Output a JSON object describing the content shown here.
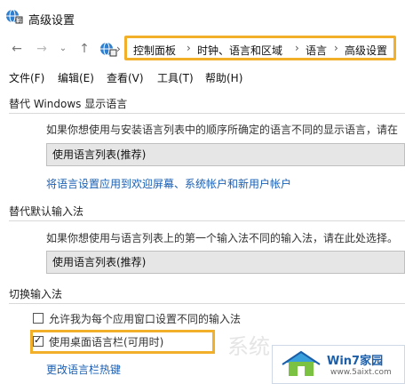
{
  "window": {
    "title": "高级设置"
  },
  "nav": {
    "breadcrumbs": [
      "控制面板",
      "时钟、语言和区域",
      "语言",
      "高级设置"
    ]
  },
  "menu": {
    "items": [
      "文件(F)",
      "编辑(E)",
      "查看(V)",
      "工具(T)",
      "帮助(H)"
    ]
  },
  "display_lang": {
    "title": "替代 Windows 显示语言",
    "description": "如果你想使用与安装语言列表中的顺序所确定的语言不同的显示语言，请在",
    "select_value": "使用语言列表(推荐)",
    "link": "将语言设置应用到欢迎屏幕、系统帐户和新用户帐户"
  },
  "input_method": {
    "title": "替代默认输入法",
    "description": "如果你想使用与语言列表上的第一个输入法不同的输入法，请在此处选择。",
    "select_value": "使用语言列表(推荐)"
  },
  "switch_input": {
    "title": "切换输入法",
    "option1": {
      "label": "允许我为每个应用窗口设置不同的输入法",
      "checked": false
    },
    "option2": {
      "label": "使用桌面语言栏(可用时)",
      "checked": true
    },
    "link": "更改语言栏热键"
  },
  "watermark": {
    "brand": "Win7家园",
    "url": "www.5aixt.com",
    "bg_text": "系统"
  },
  "colors": {
    "highlight": "#f2b02a",
    "link": "#1a5fb4",
    "select_bg": "#e6e6e6"
  }
}
